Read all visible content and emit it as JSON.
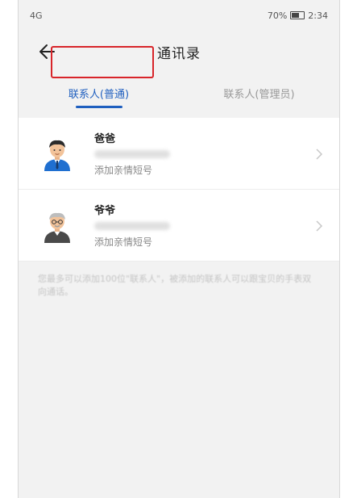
{
  "status_bar": {
    "signal": "4G",
    "battery": "70%",
    "time": "2:34"
  },
  "appbar": {
    "title": "通讯录"
  },
  "tabs": [
    {
      "label": "联系人(普通)",
      "active": true
    },
    {
      "label": "联系人(管理员)",
      "active": false
    }
  ],
  "contacts": [
    {
      "name": "爸爸",
      "sms_label": "添加亲情短号"
    },
    {
      "name": "爷爷",
      "sms_label": "添加亲情短号"
    }
  ],
  "footer_note": "您最多可以添加100位\"联系人\"，被添加的联系人可以跟宝贝的手表双向通话。",
  "colors": {
    "accent": "#1f5fbf",
    "highlight": "#d8252a",
    "background": "#f2f2f2"
  },
  "icons": [
    "back-arrow-icon",
    "chevron-right-icon",
    "battery-icon",
    "signal-icon"
  ]
}
